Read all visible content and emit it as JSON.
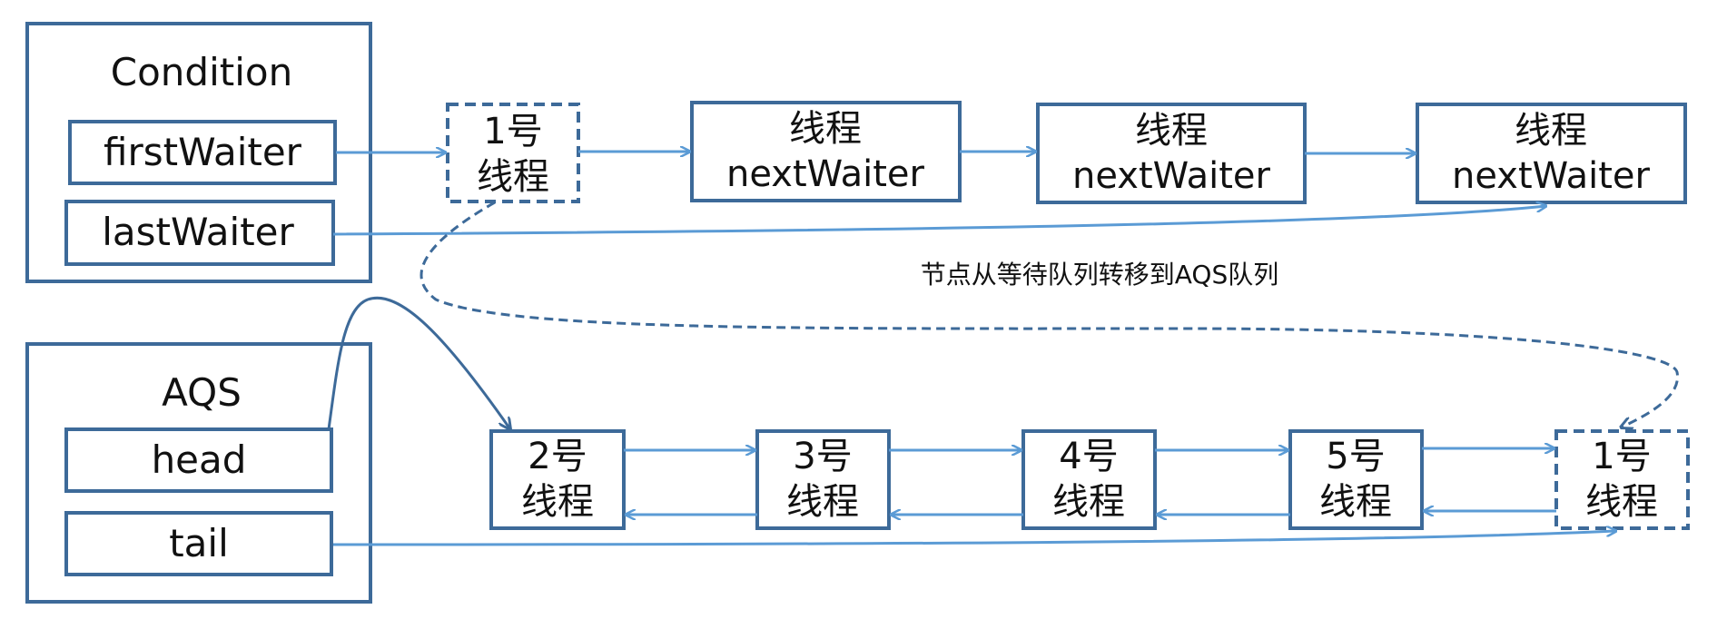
{
  "condition": {
    "title": "Condition",
    "first_waiter": "firstWaiter",
    "last_waiter": "lastWaiter"
  },
  "aqs": {
    "title": "AQS",
    "head": "head",
    "tail": "tail"
  },
  "condition_queue": [
    {
      "line1": "1号",
      "line2": "线程",
      "style": "dashed"
    },
    {
      "line1": "线程",
      "line2": "nextWaiter",
      "style": "solid"
    },
    {
      "line1": "线程",
      "line2": "nextWaiter",
      "style": "solid"
    },
    {
      "line1": "线程",
      "line2": "nextWaiter",
      "style": "solid"
    }
  ],
  "sync_queue": [
    {
      "line1": "2号",
      "line2": "线程",
      "style": "solid"
    },
    {
      "line1": "3号",
      "line2": "线程",
      "style": "solid"
    },
    {
      "line1": "4号",
      "line2": "线程",
      "style": "solid"
    },
    {
      "line1": "5号",
      "line2": "线程",
      "style": "solid"
    },
    {
      "line1": "1号",
      "line2": "线程",
      "style": "dashed"
    }
  ],
  "transfer_note": "节点从等待队列转移到AQS队列",
  "colors": {
    "box_border": "#3d6a99",
    "arrow": "#5b9bd5",
    "text": "#111111"
  }
}
